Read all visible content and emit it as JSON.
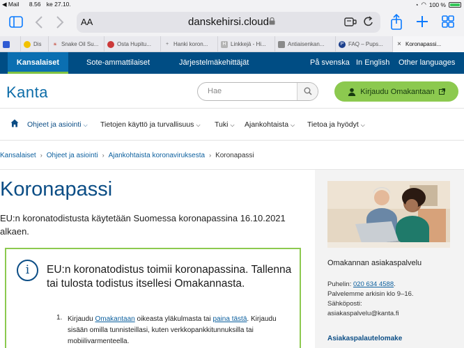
{
  "status": {
    "carrier": "Mail",
    "time": "8.56",
    "date": "ke 27.10.",
    "battery": "100 %"
  },
  "browser": {
    "reader_label": "AA",
    "url": "danskehirsi.cloud"
  },
  "tabs": [
    {
      "label": "",
      "color": "#2f5bd3",
      "fav": ""
    },
    {
      "label": "Dis",
      "color": "#222222",
      "fav": ""
    },
    {
      "label": "Snake Oil Su...",
      "color": "#c33b2b",
      "fav": "☀"
    },
    {
      "label": "Osta Hupitu...",
      "color": "#cc3a3a",
      "fav": ""
    },
    {
      "label": "Hanki koron...",
      "color": "#9a9a9a",
      "fav": "+"
    },
    {
      "label": "Linkkejä - Hi...",
      "color": "#b4b4b4",
      "fav": "H"
    },
    {
      "label": "Antiaisenkan...",
      "color": "#8a8a8a",
      "fav": ""
    },
    {
      "label": "FAQ – Pups...",
      "color": "#1c3f8c",
      "fav": "P"
    },
    {
      "label": "Koronapassi...",
      "color": "#444444",
      "fav": "×"
    }
  ],
  "topnav": {
    "items": [
      "Kansalaiset",
      "Sote-ammattilaiset",
      "Järjestelmäkehittäjät"
    ],
    "languages": [
      "På svenska",
      "In English",
      "Other languages"
    ]
  },
  "header": {
    "logo": "Kanta",
    "search_placeholder": "Hae",
    "login_label": "Kirjaudu Omakantaan"
  },
  "mainnav": {
    "items": [
      "Ohjeet ja asiointi",
      "Tietojen käyttö ja turvallisuus",
      "Tuki",
      "Ajankohtaista",
      "Tietoa ja hyödyt"
    ]
  },
  "breadcrumb": {
    "items": [
      "Kansalaiset",
      "Ohjeet ja asiointi",
      "Ajankohtaista koronaviruksesta"
    ],
    "current": "Koronapassi"
  },
  "main": {
    "title": "Koronapassi",
    "intro": "EU:n koronatodistusta käytetään Suomessa koronapassina 16.10.2021 alkaen.",
    "info_heading": "EU:n koronatodistus toimii koronapassina. Tallenna tai tulosta todistus itsellesi Omakannasta.",
    "step_number": "1.",
    "step_pre": "Kirjaudu ",
    "step_link1": "Omakantaan",
    "step_mid": " oikeasta yläkulmasta tai ",
    "step_link2": "paina tästä",
    "step_post": ". Kirjaudu sisään omilla tunnisteillasi, kuten verkkopankkitunnuksilla tai mobiilivarmenteella."
  },
  "sidebar": {
    "title": "Omakannan asiakaspalvelu",
    "phone_label": "Puhelin: ",
    "phone": "020 634 4588",
    "hours": "Palvelemme arkisin klo 9–16.",
    "email_label": "Sähköposti:",
    "email": "asiakaspalvelu@kanta.fi",
    "feedback_link": "Asiakaspalautelomake"
  }
}
